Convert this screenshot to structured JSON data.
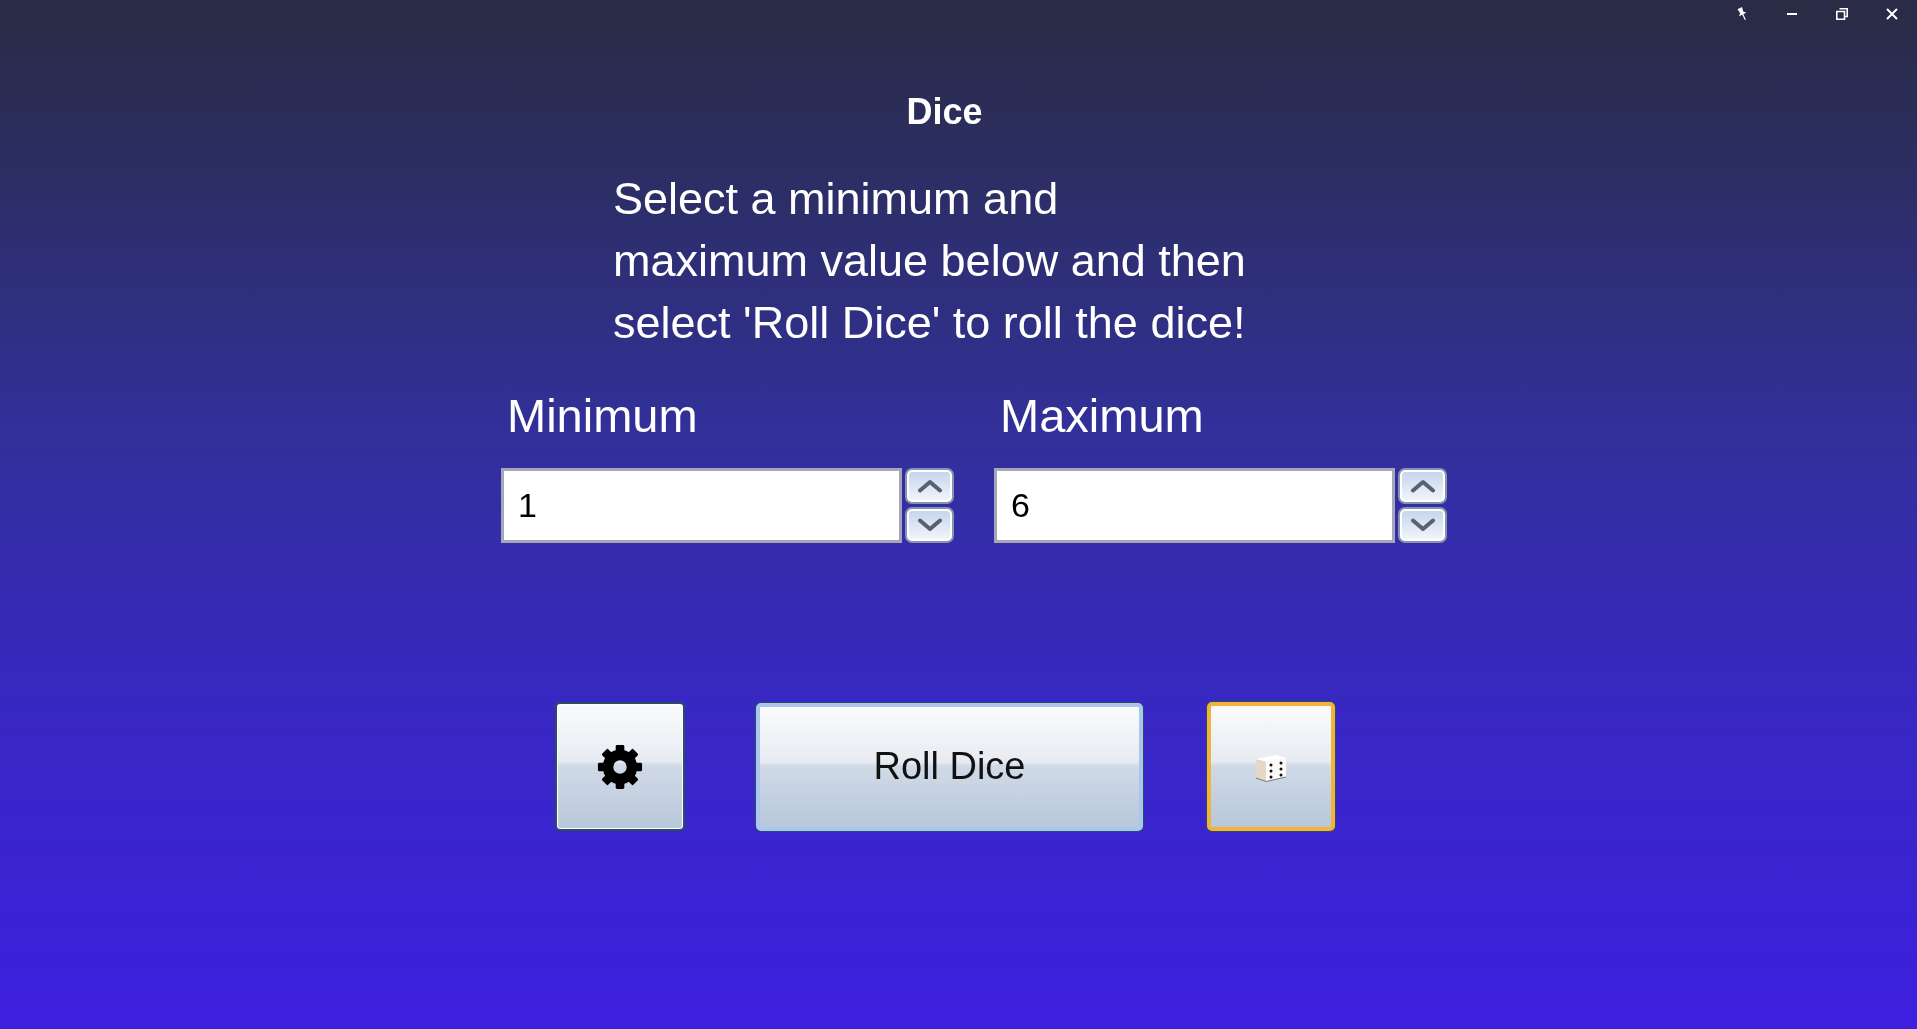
{
  "title": "Dice",
  "instructions": "Select a minimum and maximum value below and then select 'Roll Dice' to roll the dice!",
  "fields": [
    {
      "label": "Minimum",
      "value": "1"
    },
    {
      "label": "Maximum",
      "value": "6"
    }
  ],
  "buttons": [
    {
      "kind": "gear",
      "default": false,
      "focused": false
    },
    {
      "kind": "text",
      "label": "Roll Dice",
      "default": true,
      "focused": false
    },
    {
      "kind": "die",
      "default": false,
      "focused": true
    }
  ]
}
